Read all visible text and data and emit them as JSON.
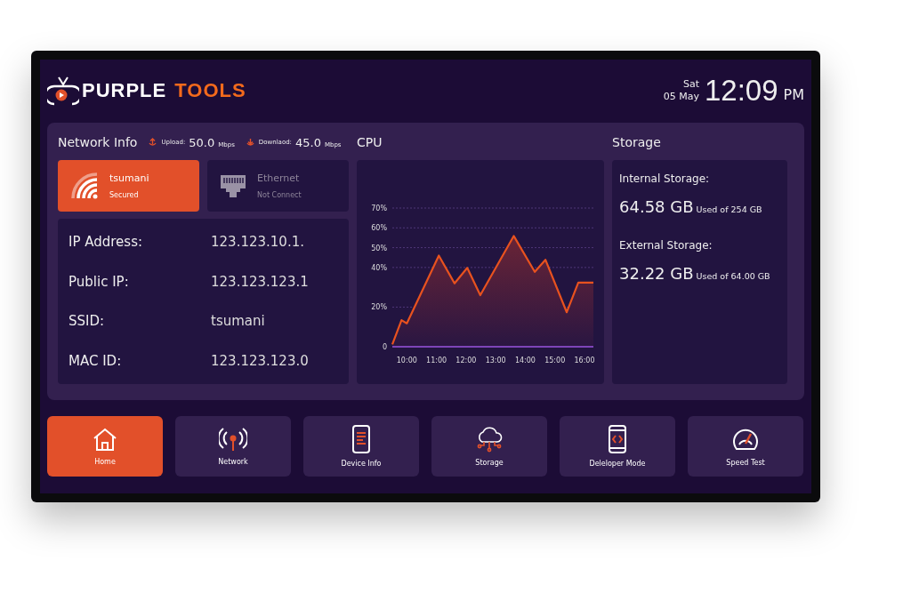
{
  "header": {
    "logo_word_1": "PURPLE",
    "logo_word_2": "TOOLS",
    "day": "Sat",
    "date": "05 May",
    "time": "12:09",
    "ampm": "PM"
  },
  "network": {
    "title": "Network Info",
    "upload_label": "Upload:",
    "upload_value": "50.0",
    "upload_unit": "Mbps",
    "download_label": "Downlaod:",
    "download_value": "45.0",
    "download_unit": "Mbps",
    "connections": [
      {
        "kind": "wifi",
        "name": "tsumani",
        "status": "Secured",
        "selected": true
      },
      {
        "kind": "ethernet",
        "name": "Ethernet",
        "status": "Not Connect",
        "selected": false
      }
    ],
    "details": [
      {
        "label": "IP Address:",
        "value": "123.123.10.1."
      },
      {
        "label": "Public IP:",
        "value": "123.123.123.1"
      },
      {
        "label": "SSID:",
        "value": "tsumani"
      },
      {
        "label": "MAC ID:",
        "value": "123.123.123.0"
      }
    ]
  },
  "cpu": {
    "title": "CPU",
    "chart_data": {
      "type": "area",
      "x": [
        9.51,
        9.82,
        10.0,
        11.08,
        11.61,
        12.04,
        12.48,
        13.61,
        14.32,
        14.68,
        15.4,
        15.79,
        16.3
      ],
      "series": [
        {
          "color": "#e8521f",
          "values": [
            1.2,
            13.4,
            11.8,
            46,
            32,
            39.8,
            26,
            55.9,
            37.8,
            43.9,
            17.4,
            32.4,
            32.4
          ]
        }
      ],
      "xlim": [
        9.51,
        16.3
      ],
      "ylim": [
        0,
        70
      ],
      "grid": true,
      "xticks": [
        {
          "value": 10,
          "label": "10:00"
        },
        {
          "value": 11,
          "label": "11:00"
        },
        {
          "value": 12,
          "label": "12:00"
        },
        {
          "value": 13,
          "label": "13:00"
        },
        {
          "value": 14,
          "label": "14:00"
        },
        {
          "value": 15,
          "label": "15:00"
        },
        {
          "value": 16,
          "label": "16:00"
        }
      ],
      "yticks": [
        {
          "value": 0,
          "label": "0"
        },
        {
          "value": 20,
          "label": "20%"
        },
        {
          "value": 40,
          "label": "40%"
        },
        {
          "value": 50,
          "label": "50%"
        },
        {
          "value": 60,
          "label": "60%"
        },
        {
          "value": 70,
          "label": "70%"
        }
      ]
    }
  },
  "storage": {
    "title": "Storage",
    "items": [
      {
        "label": "Internal Storage:",
        "used": "64.58 GB",
        "total": "Used of 254 GB"
      },
      {
        "label": "External  Storage:",
        "used": "32.22 GB",
        "total": "Used of 64.00 GB"
      }
    ]
  },
  "nav": [
    {
      "kind": "home",
      "label": "Home",
      "selected": true
    },
    {
      "kind": "network",
      "label": "Network",
      "selected": false
    },
    {
      "kind": "device",
      "label": "Device Info",
      "selected": false
    },
    {
      "kind": "storage",
      "label": "Storage",
      "selected": false
    },
    {
      "kind": "developer",
      "label": "Deleloper Mode",
      "selected": false
    },
    {
      "kind": "speed",
      "label": "Speed Test",
      "selected": false
    }
  ]
}
